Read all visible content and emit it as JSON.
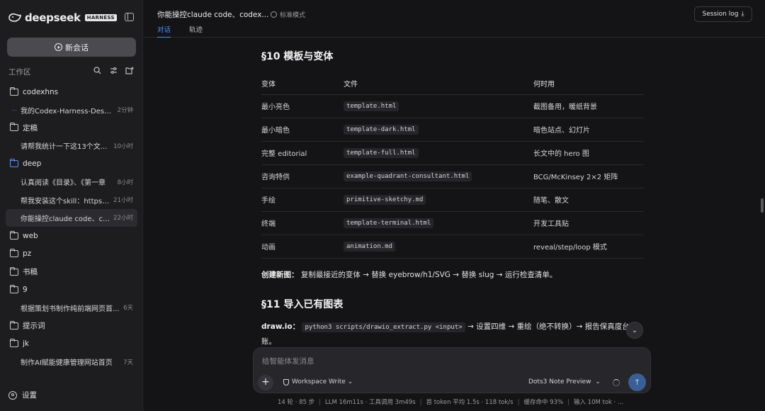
{
  "app": {
    "brand": "deepseek",
    "badge": "HARNESS"
  },
  "sidebar": {
    "new_chat": "新会话",
    "workspace_label": "工作区",
    "items": [
      {
        "type": "folder",
        "label": "codexhns"
      },
      {
        "type": "chat",
        "label": "我的Codex-Harness-Desk...",
        "time": "2分钟",
        "dots": true
      },
      {
        "type": "folder",
        "label": "定稿"
      },
      {
        "type": "chat",
        "label": "请帮我统计一下这13个文...",
        "time": "10小时"
      },
      {
        "type": "folder",
        "label": "deep",
        "highlight": true
      },
      {
        "type": "chat",
        "label": "认真阅读《目录》、《第一章",
        "time": "8小时"
      },
      {
        "type": "chat",
        "label": "帮我安装这个skill：https:/...",
        "time": "21小时"
      },
      {
        "type": "chat",
        "label": "你能操控claude code、co...",
        "time": "22小时",
        "active": true
      },
      {
        "type": "folder",
        "label": "web"
      },
      {
        "type": "folder",
        "label": "pz"
      },
      {
        "type": "folder",
        "label": "书稿"
      },
      {
        "type": "folder",
        "label": "9"
      },
      {
        "type": "chat",
        "label": "根据策划书制作纯前端网页首...",
        "time": "6天"
      },
      {
        "type": "folder",
        "label": "提示词"
      },
      {
        "type": "folder",
        "label": "jk"
      },
      {
        "type": "chat",
        "label": "制作AI赋能健康管理网站首页",
        "time": "7天"
      }
    ],
    "settings": "设置"
  },
  "header": {
    "title": "你能操控claude code、codex...",
    "mode": "标准模式",
    "tabs": [
      "对话",
      "轨迹"
    ],
    "session_log": "Session log"
  },
  "doc": {
    "s10_title": "§10 模板与变体",
    "table_headers": [
      "变体",
      "文件",
      "何时用"
    ],
    "rows": [
      [
        "最小亮色",
        "template.html",
        "截图备用，暖纸背景"
      ],
      [
        "最小暗色",
        "template-dark.html",
        "暗色站点、幻灯片"
      ],
      [
        "完整 editorial",
        "template-full.html",
        "长文中的 hero 图"
      ],
      [
        "咨询特供",
        "example-quadrant-consultant.html",
        "BCG/McKinsey 2×2 矩阵"
      ],
      [
        "手绘",
        "primitive-sketchy.md",
        "随笔、散文"
      ],
      [
        "终端",
        "template-terminal.html",
        "开发工具贴"
      ],
      [
        "动画",
        "animation.md",
        "reveal/step/loop 模式"
      ]
    ],
    "new_fig_label": "创建新图：",
    "new_fig_text": " 复制最接近的变体 → 替换 eyebrow/h1/SVG → 替换 slug → 运行检查清单。",
    "s11_title": "§11 导入已有图表",
    "drawio_label": "draw.io：",
    "drawio_code": "python3 scripts/drawio_extract.py <input>",
    "drawio_text": " → 设置四维 → 重绘（绝不转换）→ 报告保真度台账。"
  },
  "composer": {
    "placeholder": "给智能体发消息",
    "workspace": "Workspace Write",
    "model": "Dots3 Note Preview"
  },
  "status": [
    "14 轮 · 85 步",
    "LLM 16m11s · 工具调用 3m49s",
    "首 token 平均 1.5s · 118 tok/s",
    "缓存命中 93%",
    "输入 10M tok · ..."
  ]
}
